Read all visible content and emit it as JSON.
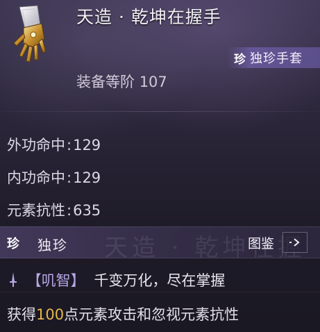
{
  "item": {
    "icon": "gauntlet-icon",
    "name": "天造 · 乾坤在握手",
    "rarity_icon_text": "珍",
    "rarity_tag": "独珍手套",
    "gear_level_label": "装备等阶",
    "gear_level_value": "107"
  },
  "stats": [
    {
      "label": "外功命中",
      "sep": ":",
      "value": "129"
    },
    {
      "label": "内功命中",
      "sep": ":",
      "value": "129"
    },
    {
      "label": "元素抗性",
      "sep": ":",
      "value": "635"
    }
  ],
  "section": {
    "rarity_icon_text": "珍",
    "rarity_label": "独珍",
    "watermark": "天造 · 乾坤在握",
    "codex_label": "图鉴",
    "codex_arrow": "->"
  },
  "skill": {
    "icon": "sword-icon",
    "name": "【叽智】",
    "slogan": "千变万化，尽在掌握",
    "desc_before": "获得",
    "desc_highlight": "100",
    "desc_after": "点元素攻击和忽视元素抗性"
  },
  "colors": {
    "skill_name": "#b8a6e6",
    "highlight_number": "#e7b64b",
    "rarity_tag_bg": "#5b4f8a"
  }
}
